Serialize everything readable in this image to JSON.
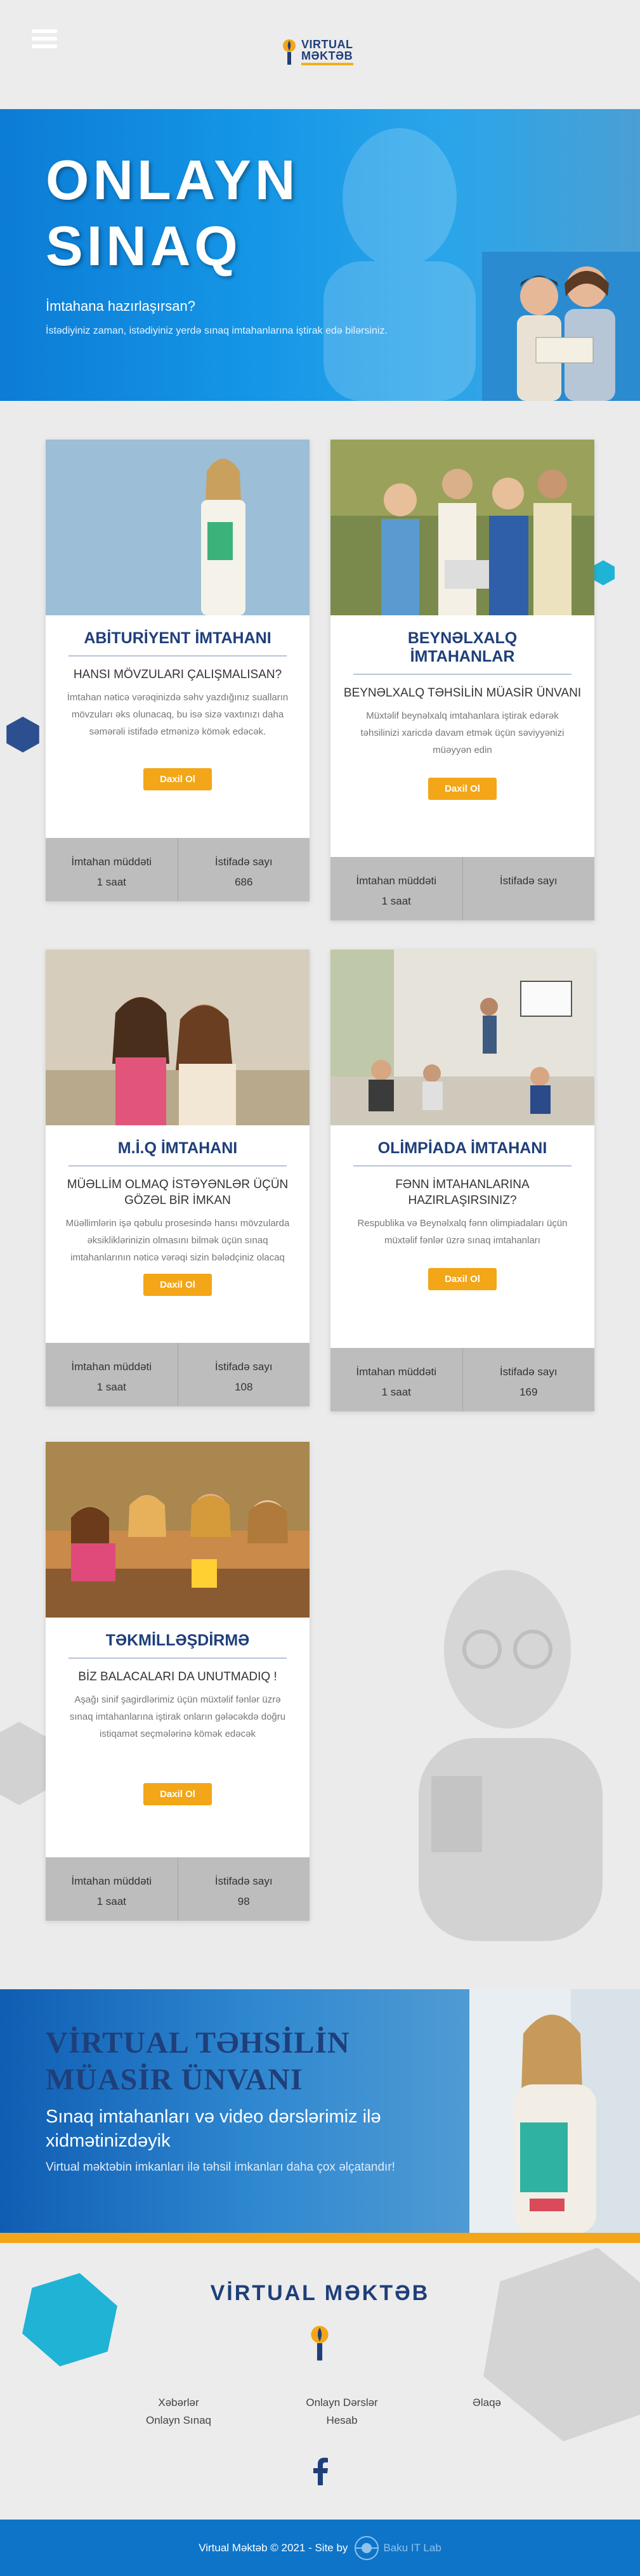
{
  "header": {
    "logo_line1": "VIRTUAL",
    "logo_line2": "MƏKTƏB"
  },
  "hero": {
    "title_line1": "ONLAYN",
    "title_line2": "SINAQ",
    "question": "İmtahana hazırlaşırsan?",
    "description": "İstədiyiniz zaman, istədiyiniz yerdə sınaq imtahanlarına iştirak edə bilərsiniz."
  },
  "cards": [
    {
      "title": "ABİTURİYENT İMTAHANI",
      "subtitle": "HANSI MÖVZULARI ÇALIŞMALISAN?",
      "description": "İmtahan nəticə vərəqinizdə səhv yazdığınız sualların mövzuları əks olunacaq, bu isə sizə vaxtınızı daha səmərəli istifadə etmənizə kömək edəcək.",
      "button": "Daxil Ol",
      "stat1_label": "İmtahan müddəti",
      "stat1_value": "1 saat",
      "stat2_label": "İstifadə sayı",
      "stat2_value": "686"
    },
    {
      "title": "BEYNƏLXALQ İMTAHANLAR",
      "subtitle": "BEYNƏLXALQ TƏHSİLİN MÜASİR ÜNVANI",
      "description": "Müxtəlif beynəlxalq imtahanlara iştirak edərək təhsilinizi xaricdə davam etmək üçün səviyyənizi müəyyən edin",
      "button": "Daxil Ol",
      "stat1_label": "İmtahan müddəti",
      "stat1_value": "1 saat",
      "stat2_label": "İstifadə sayı",
      "stat2_value": ""
    },
    {
      "title": "M.İ.Q İMTAHANI",
      "subtitle": "MÜƏLLİM OLMAQ İSTƏYƏNLƏR ÜÇÜN GÖZƏL BİR İMKAN",
      "description": "Müəllimlərin işə qəbulu prosesində hansı mövzularda əksikliklərinizin olmasını bilmək üçün sınaq imtahanlarının nəticə vərəqi sizin bələdçiniz olacaq",
      "button": "Daxil Ol",
      "stat1_label": "İmtahan müddəti",
      "stat1_value": "1 saat",
      "stat2_label": "İstifadə sayı",
      "stat2_value": "108"
    },
    {
      "title": "OLİMPİADA İMTAHANI",
      "subtitle": "FƏNN İMTAHANLARINA HAZIRLAŞIRSINIZ?",
      "description": "Respublika və Beynəlxalq fənn olimpiadaları üçün müxtəlif fənlər üzrə sınaq imtahanları",
      "button": "Daxil Ol",
      "stat1_label": "İmtahan müddəti",
      "stat1_value": "1 saat",
      "stat2_label": "İstifadə sayı",
      "stat2_value": "169"
    },
    {
      "title": "TƏKMİLLƏŞDİRMƏ",
      "subtitle": "BİZ BALACALARI DA UNUTMADIQ !",
      "description": "Aşağı sinif şagirdlərimiz üçün müxtəlif fənlər üzrə sınaq imtahanlarına iştirak onların gələcəkdə doğru istiqamət seçmələrinə kömək edəcək",
      "button": "Daxil Ol",
      "stat1_label": "İmtahan müddəti",
      "stat1_value": "1 saat",
      "stat2_label": "İstifadə sayı",
      "stat2_value": "98"
    }
  ],
  "banner": {
    "title_line1": "VİRTUAL TƏHSİLİN",
    "title_line2": "MÜASİR ÜNVANI",
    "subtitle": "Sınaq imtahanları və video dərslərimiz ilə xidmətinizdəyik",
    "note": "Virtual məktəbin imkanları ilə təhsil imkanları daha çox əlçatandır!"
  },
  "footer": {
    "title": "VİRTUAL MƏKTƏB",
    "links_col1": [
      "Xəbərlər",
      "Onlayn Sınaq"
    ],
    "links_col2": [
      "Onlayn Dərslər",
      "Hesab"
    ],
    "links_col3": [
      "Əlaqə"
    ]
  },
  "bottom": {
    "copyright": "Virtual Məktəb © 2021 - Site by",
    "company": "Baku IT Lab"
  },
  "colors": {
    "brand_blue": "#1f3f7a",
    "accent_orange": "#f3a617",
    "hero_blue": "#1596e6",
    "footer_blue": "#0e74c8"
  }
}
